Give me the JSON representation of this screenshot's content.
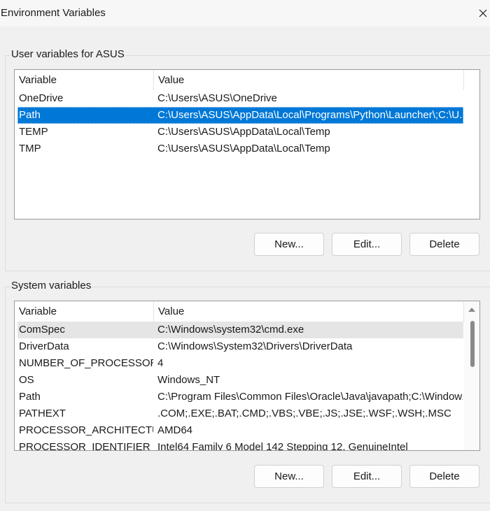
{
  "window": {
    "title": "Environment Variables"
  },
  "user_section": {
    "label": "User variables for ASUS",
    "columns": [
      "Variable",
      "Value"
    ],
    "rows": [
      {
        "name": "OneDrive",
        "value": "C:\\Users\\ASUS\\OneDrive"
      },
      {
        "name": "Path",
        "value": "C:\\Users\\ASUS\\AppData\\Local\\Programs\\Python\\Launcher\\;C:\\U..."
      },
      {
        "name": "TEMP",
        "value": "C:\\Users\\ASUS\\AppData\\Local\\Temp"
      },
      {
        "name": "TMP",
        "value": "C:\\Users\\ASUS\\AppData\\Local\\Temp"
      }
    ],
    "selected_index": 1,
    "buttons": {
      "new": "New...",
      "edit": "Edit...",
      "delete": "Delete"
    }
  },
  "system_section": {
    "label": "System variables",
    "columns": [
      "Variable",
      "Value"
    ],
    "rows": [
      {
        "name": "ComSpec",
        "value": "C:\\Windows\\system32\\cmd.exe"
      },
      {
        "name": "DriverData",
        "value": "C:\\Windows\\System32\\Drivers\\DriverData"
      },
      {
        "name": "NUMBER_OF_PROCESSORS",
        "value": "4"
      },
      {
        "name": "OS",
        "value": "Windows_NT"
      },
      {
        "name": "Path",
        "value": "C:\\Program Files\\Common Files\\Oracle\\Java\\javapath;C:\\Window..."
      },
      {
        "name": "PATHEXT",
        "value": ".COM;.EXE;.BAT;.CMD;.VBS;.VBE;.JS;.JSE;.WSF;.WSH;.MSC"
      },
      {
        "name": "PROCESSOR_ARCHITECTURE",
        "value": "AMD64"
      },
      {
        "name": "PROCESSOR_IDENTIFIER",
        "value": "Intel64 Family 6 Model 142 Stepping 12, GenuineIntel"
      }
    ],
    "hover_index": 0,
    "buttons": {
      "new": "New...",
      "edit": "Edit...",
      "delete": "Delete"
    }
  },
  "colors": {
    "selection": "#0078d7",
    "hover": "#e5e5e5"
  },
  "icons": {
    "close": "close-icon",
    "scroll_up": "scroll-up-arrow-icon"
  }
}
